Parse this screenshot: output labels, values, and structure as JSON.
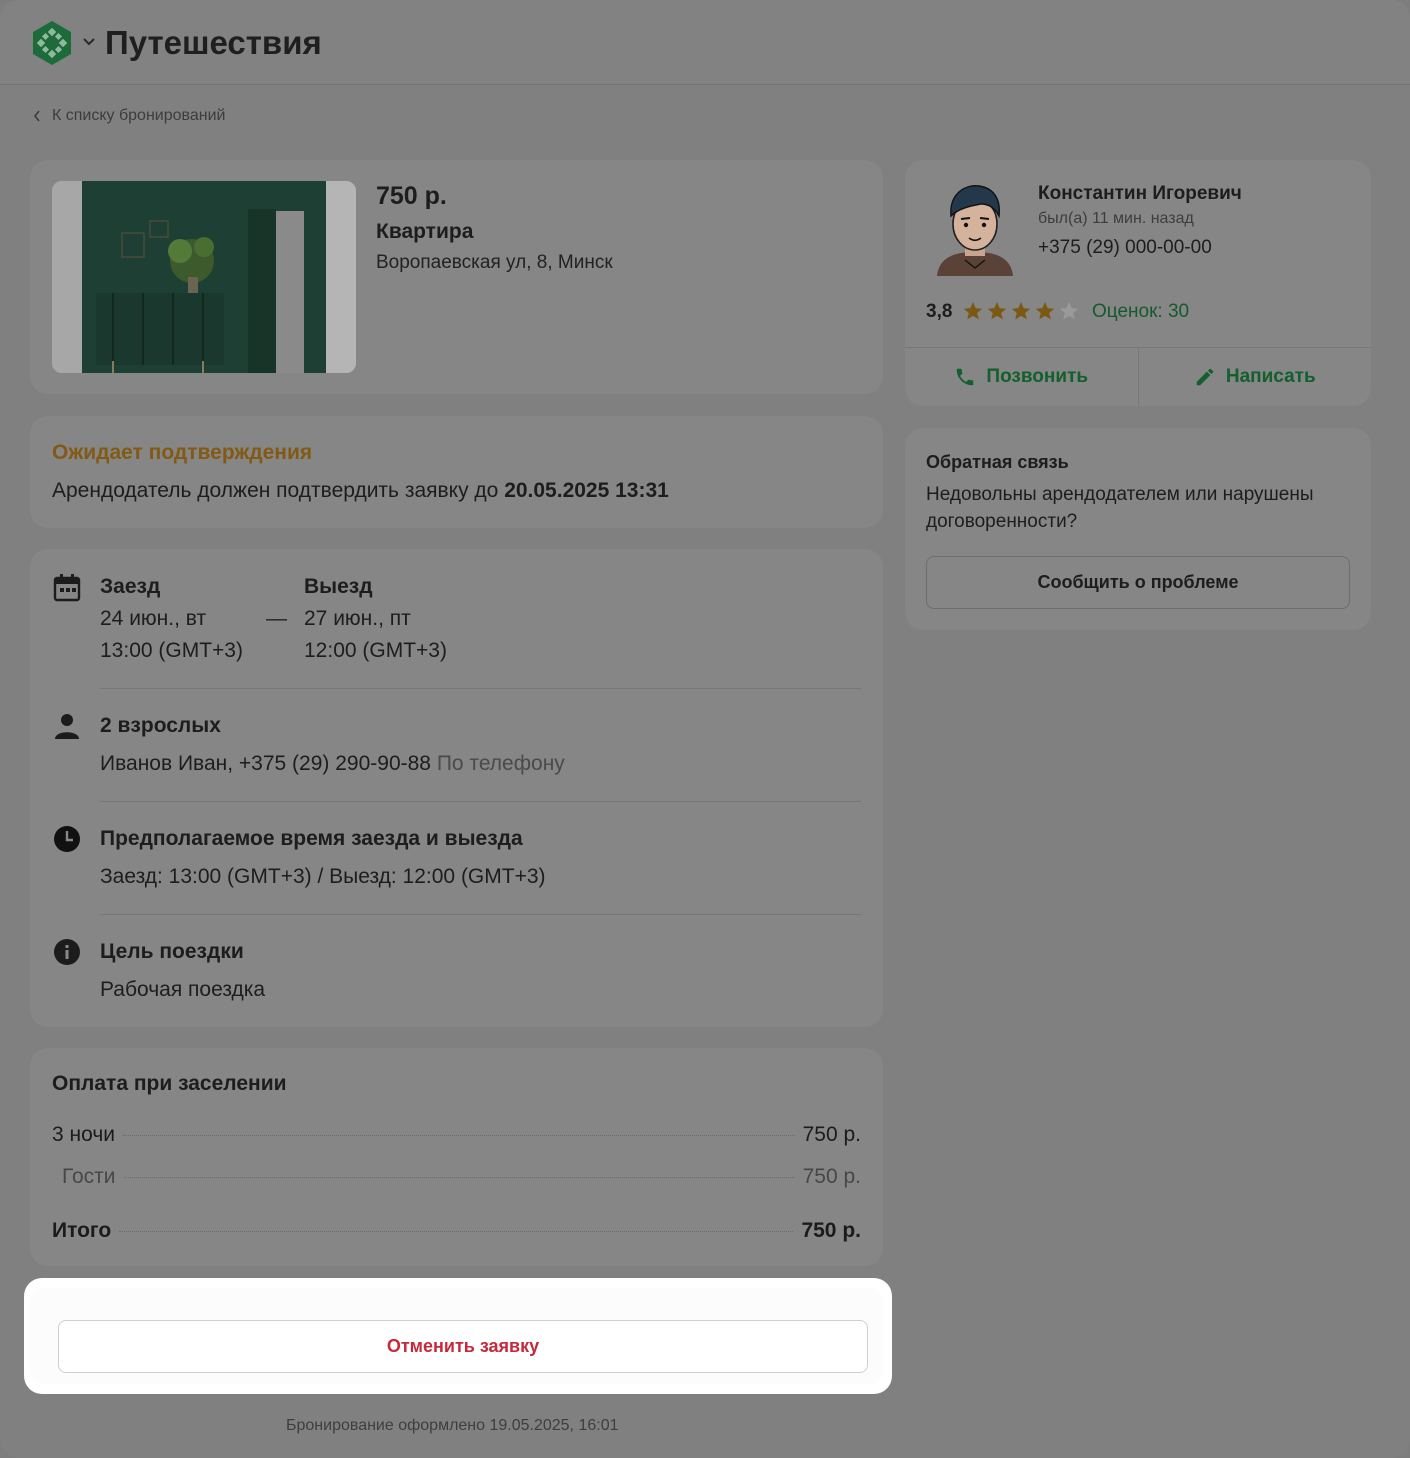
{
  "header": {
    "title": "Путешествия",
    "logo_icon": "app-logo-icon",
    "brand_color": "#1f8a4c"
  },
  "nav": {
    "back_label": "К списку бронирований"
  },
  "listing": {
    "price": "750 р.",
    "type": "Квартира",
    "address": "Воропаевская ул, 8, Минск"
  },
  "status": {
    "title": "Ожидает подтверждения",
    "text_prefix": "Арендодатель должен подтвердить заявку до",
    "deadline": "20.05.2025 13:31",
    "color": "#825a14"
  },
  "stay": {
    "checkin_label": "Заезд",
    "checkin_date": "24 июн., вт",
    "checkin_time": "13:00 (GMT+3)",
    "dash": "—",
    "checkout_label": "Выезд",
    "checkout_date": "27 июн., пт",
    "checkout_time": "12:00 (GMT+3)"
  },
  "guests": {
    "title": "2 взрослых",
    "contact": "Иванов Иван, +375 (29) 290-90-88",
    "contact_method": "По телефону"
  },
  "arrival": {
    "title": "Предполагаемое время заезда и выезда",
    "text": "Заезд: 13:00 (GMT+3) / Выезд: 12:00 (GMT+3)"
  },
  "purpose": {
    "title": "Цель поездки",
    "text": "Рабочая поездка"
  },
  "payment": {
    "title": "Оплата при заселении",
    "rows": [
      {
        "label": "3 ночи",
        "value": "750 р."
      },
      {
        "label": "Гости",
        "value": "750 р."
      }
    ],
    "total_label": "Итого",
    "total_value": "750 р."
  },
  "actions": {
    "cancel_label": "Отменить заявку",
    "cancel_color": "#c8283b"
  },
  "footer": {
    "booked_at": "Бронирование оформлено 19.05.2025, 16:01"
  },
  "host": {
    "name": "Константин Игоревич",
    "last_seen": "был(а) 11 мин. назад",
    "phone": "+375 (29) 000-00-00",
    "rating": "3,8",
    "rating_value": 3.8,
    "rating_max": 5,
    "rating_count": "Оценок: 30",
    "call_label": "Позвонить",
    "write_label": "Написать"
  },
  "feedback": {
    "title": "Обратная связь",
    "text": "Недовольны арендодателем или нарушены договоренности?",
    "button_label": "Сообщить о проблеме"
  }
}
